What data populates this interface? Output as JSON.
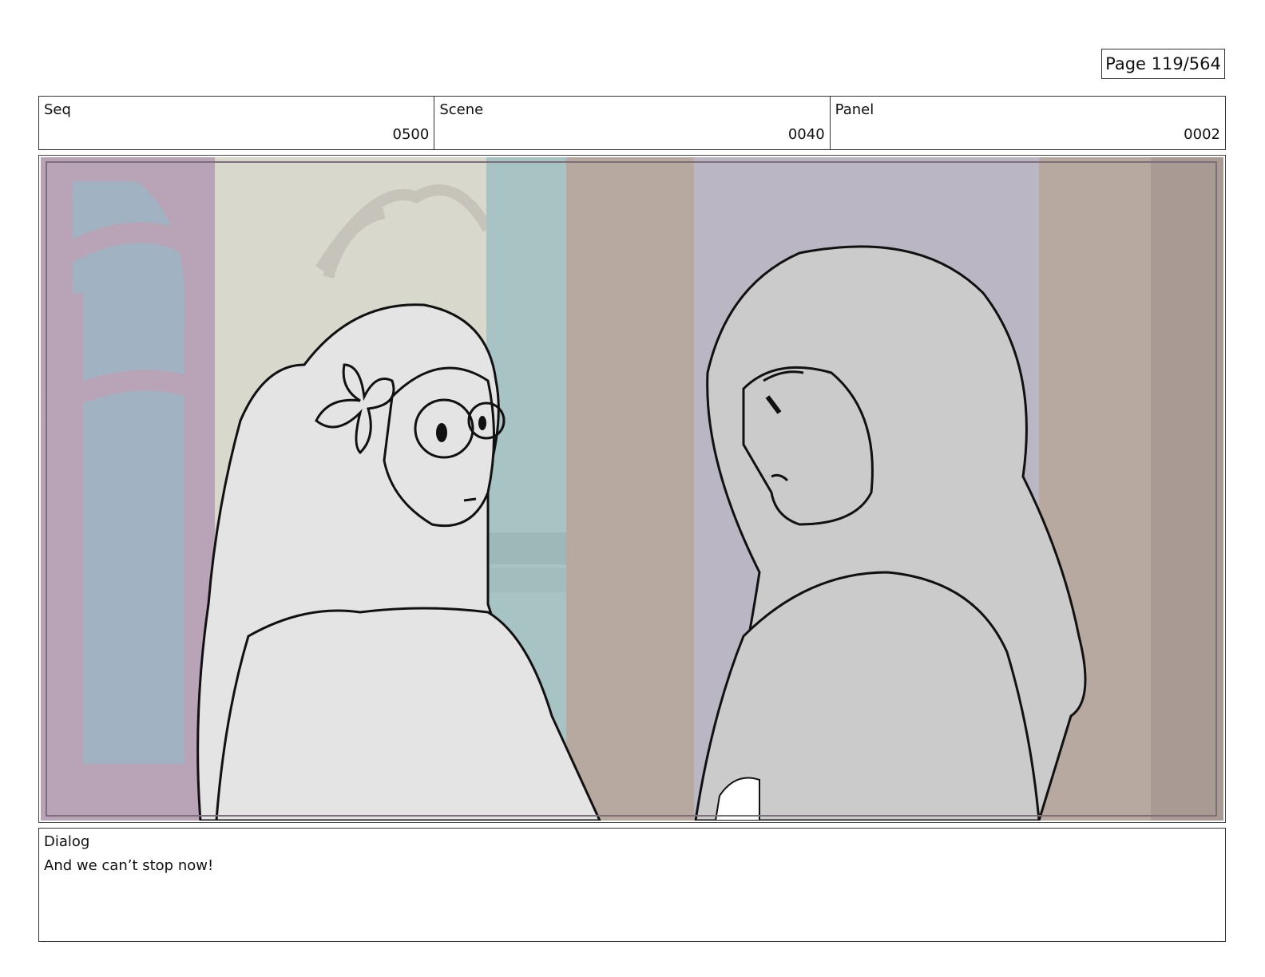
{
  "page": {
    "label": "Page 119/564"
  },
  "header": {
    "seq": {
      "label": "Seq",
      "value": "0500"
    },
    "scene": {
      "label": "Scene",
      "value": "0040"
    },
    "panel": {
      "label": "Panel",
      "value": "0002"
    }
  },
  "dialog": {
    "label": "Dialog",
    "text": "And we can’t stop now!"
  },
  "colors": {
    "pink_frame": "#b9a3b6",
    "window_blue": "#a1b3c2",
    "wall_cream": "#d9d8cd",
    "column_teal": "#a8c3c4",
    "curtain_brown": "#b7a8a0",
    "back_lavender": "#bbb6c3",
    "character_fill": "#e4e4e4",
    "character_dark_fill": "#cbcbcb",
    "ink": "#111111"
  }
}
